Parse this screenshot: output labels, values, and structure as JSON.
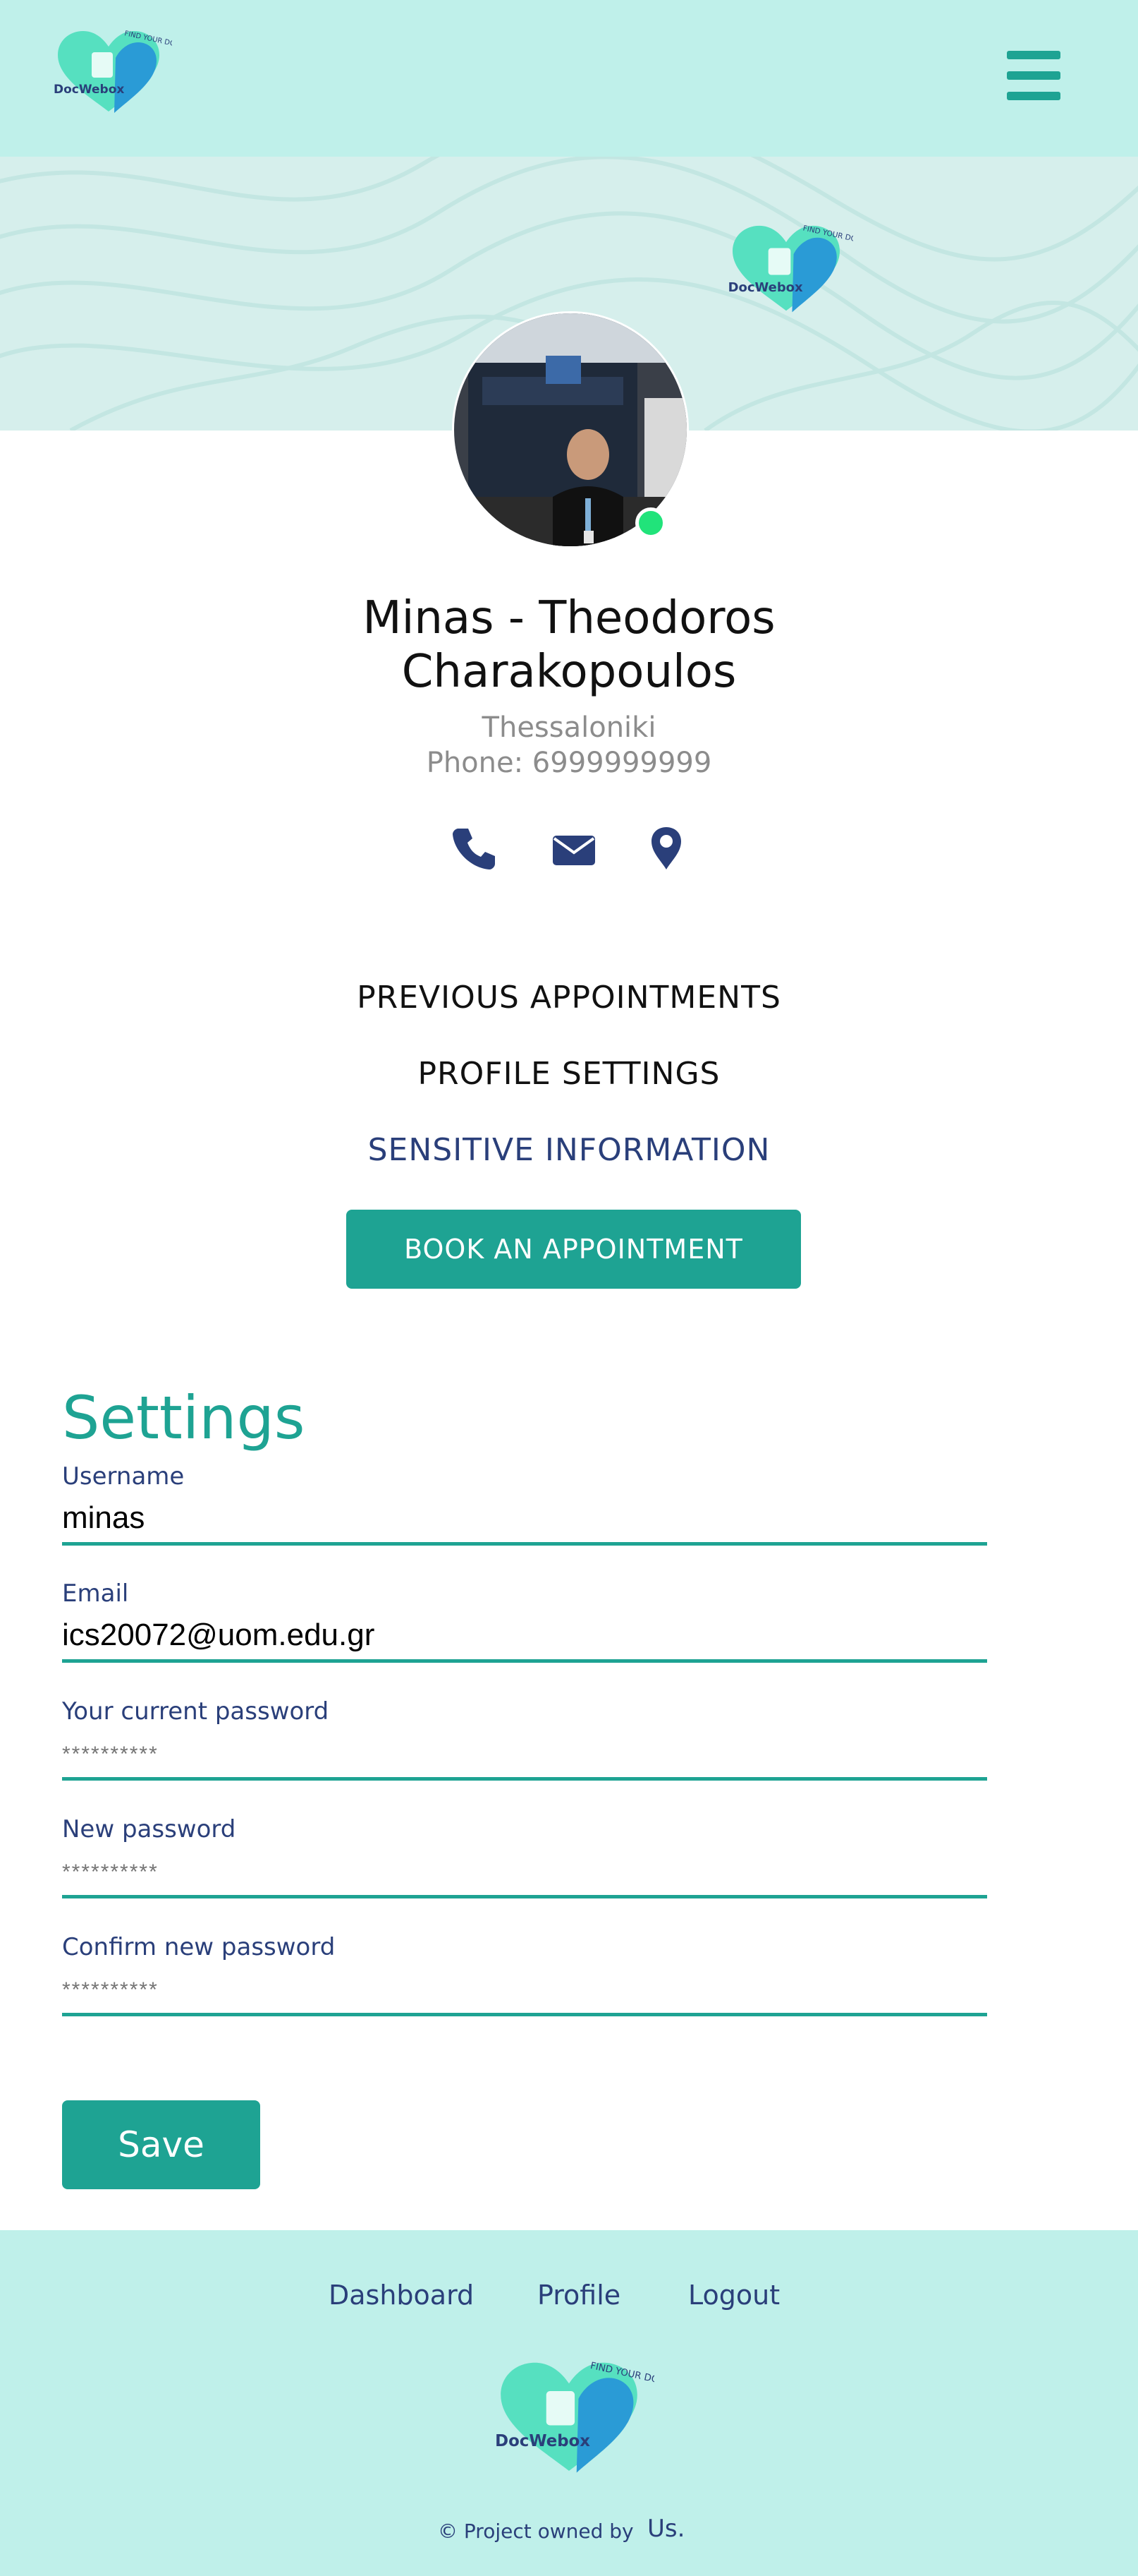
{
  "brand": {
    "name": "DocWebox",
    "tagline": "FIND YOUR DOCTOR",
    "colors": {
      "teal": "#1ea393",
      "mint_bg": "#bff0ea",
      "navy": "#2a3f7a",
      "online": "#21e37a"
    }
  },
  "header": {
    "menu_icon": "hamburger-menu-icon"
  },
  "profile": {
    "name": "Minas - Theodoros Charakopoulos",
    "city": "Thessaloniki",
    "phone": "Phone: 6999999999",
    "status": "online",
    "contact_icons": [
      "phone-icon",
      "envelope-icon",
      "map-pin-icon"
    ]
  },
  "menu": {
    "previous_appointments": "PREVIOUS APPOINTMENTS",
    "profile_settings": "PROFILE SETTINGS",
    "sensitive_information": "SENSITIVE INFORMATION",
    "book_button": "BOOK AN APPOINTMENT"
  },
  "settings": {
    "title": "Settings",
    "username": {
      "label": "Username",
      "value": "minas"
    },
    "email": {
      "label": "Email",
      "value": "ics20072@uom.edu.gr"
    },
    "current_password": {
      "label": "Your current password",
      "placeholder": "**********"
    },
    "new_password": {
      "label": "New password",
      "placeholder": "**********"
    },
    "confirm_password": {
      "label": "Confirm new password",
      "placeholder": "**********"
    },
    "save_label": "Save"
  },
  "footer": {
    "links": {
      "dashboard": "Dashboard",
      "profile": "Profile",
      "logout": "Logout"
    },
    "copyright_text": "© Project owned by",
    "copyright_link": "Us."
  }
}
